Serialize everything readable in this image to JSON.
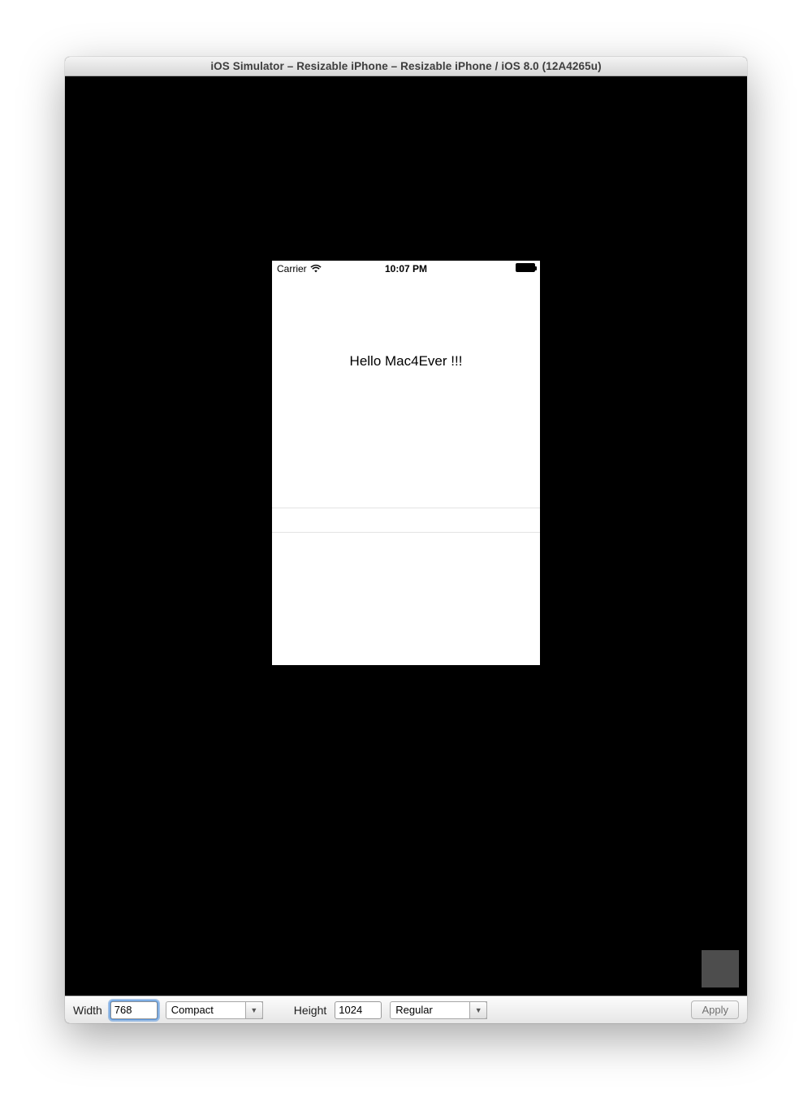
{
  "window": {
    "title": "iOS Simulator – Resizable iPhone – Resizable iPhone / iOS 8.0 (12A4265u)"
  },
  "status": {
    "carrier": "Carrier",
    "time": "10:07 PM"
  },
  "app": {
    "hello_text": "Hello Mac4Ever !!!"
  },
  "toolbar": {
    "width_label": "Width",
    "width_value": "768",
    "width_class": "Compact",
    "height_label": "Height",
    "height_value": "1024",
    "height_class": "Regular",
    "apply_label": "Apply"
  }
}
